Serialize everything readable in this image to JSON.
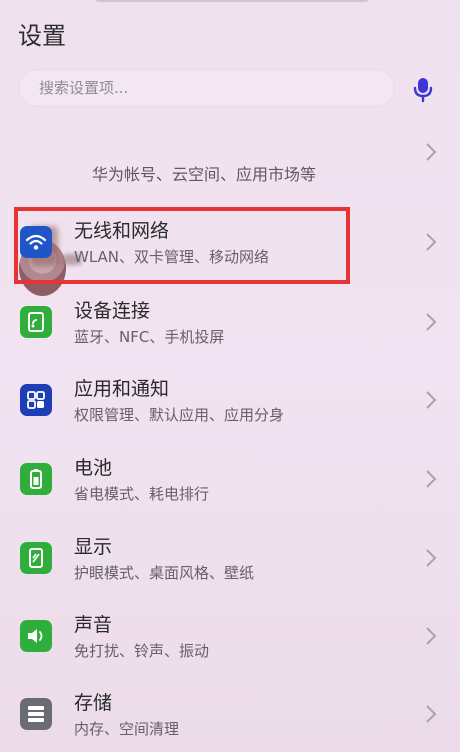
{
  "header": {
    "title": "设置"
  },
  "search": {
    "placeholder": "搜索设置项..."
  },
  "account": {
    "subtitle": "华为帐号、云空间、应用市场等"
  },
  "items": [
    {
      "title": "无线和网络",
      "subtitle": "WLAN、双卡管理、移动网络",
      "icon": "wifi-icon",
      "icon_bg": "#1e56c7"
    },
    {
      "title": "设备连接",
      "subtitle": "蓝牙、NFC、手机投屏",
      "icon": "device-connection-icon",
      "icon_bg": "#2fae3b"
    },
    {
      "title": "应用和通知",
      "subtitle": "权限管理、默认应用、应用分身",
      "icon": "apps-icon",
      "icon_bg": "#1c3fb5"
    },
    {
      "title": "电池",
      "subtitle": "省电模式、耗电排行",
      "icon": "battery-icon",
      "icon_bg": "#2fae3b"
    },
    {
      "title": "显示",
      "subtitle": "护眼模式、桌面风格、壁纸",
      "icon": "display-icon",
      "icon_bg": "#2fae3b"
    },
    {
      "title": "声音",
      "subtitle": "免打扰、铃声、振动",
      "icon": "sound-icon",
      "icon_bg": "#2fae3b"
    },
    {
      "title": "存储",
      "subtitle": "内存、空间清理",
      "icon": "storage-icon",
      "icon_bg": "#6b6b73"
    }
  ],
  "colors": {
    "highlight": "#e63333",
    "mic": "#3c35d9"
  }
}
